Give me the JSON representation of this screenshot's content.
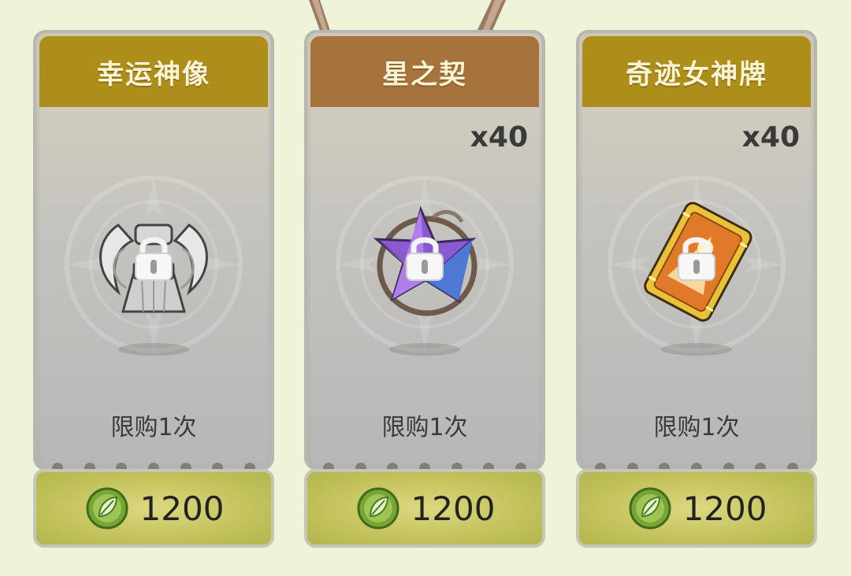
{
  "cards": [
    {
      "title": "幸运神像",
      "title_color": "#ad8e1a",
      "quantity": "",
      "item_icon": "lucky-statue-icon",
      "locked": true,
      "limit": "限购1次",
      "price": "1200",
      "currency_icon": "leaf-coin-icon"
    },
    {
      "title": "星之契",
      "title_color": "#a6733d",
      "quantity": "x40",
      "item_icon": "star-contract-icon",
      "locked": true,
      "limit": "限购1次",
      "price": "1200",
      "currency_icon": "leaf-coin-icon"
    },
    {
      "title": "奇迹女神牌",
      "title_color": "#ad8e1a",
      "quantity": "x40",
      "item_icon": "miracle-goddess-card-icon",
      "locked": true,
      "limit": "限购1次",
      "price": "1200",
      "currency_icon": "leaf-coin-icon"
    }
  ]
}
